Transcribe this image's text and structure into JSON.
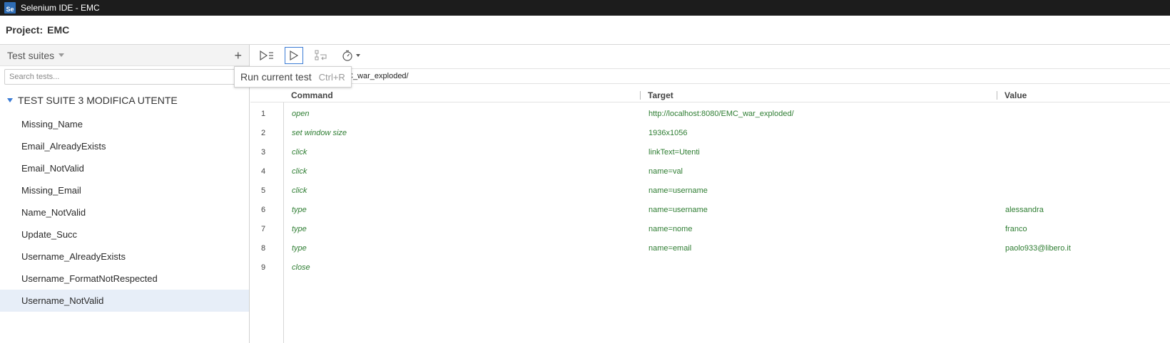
{
  "window": {
    "title": "Selenium IDE - EMC",
    "logo_text": "Se"
  },
  "project": {
    "label": "Project:",
    "name": "EMC"
  },
  "sidebar": {
    "dropdown_label": "Test suites",
    "add_label": "+",
    "search_placeholder": "Search tests...",
    "suite_name": "TEST SUITE 3 MODIFICA UTENTE",
    "tests": [
      "Missing_Name",
      "Email_AlreadyExists",
      "Email_NotValid",
      "Missing_Email",
      "Name_NotValid",
      "Update_Succ",
      "Username_AlreadyExists",
      "Username_FormatNotRespected",
      "Username_NotValid"
    ],
    "selected_test": "Username_NotValid"
  },
  "toolbar": {
    "buttons": [
      "run-all-tests-icon",
      "run-current-test-icon",
      "step-over-icon",
      "test-speed-icon"
    ],
    "tooltip": {
      "label": "Run current test",
      "shortcut": "Ctrl+R"
    }
  },
  "url_bar": {
    "visible_text": "C_war_exploded/"
  },
  "table": {
    "headers": {
      "command": "Command",
      "target": "Target",
      "value": "Value"
    },
    "rows": [
      {
        "num": "1",
        "command": "open",
        "target": "http://localhost:8080/EMC_war_exploded/",
        "value": ""
      },
      {
        "num": "2",
        "command": "set window size",
        "target": "1936x1056",
        "value": ""
      },
      {
        "num": "3",
        "command": "click",
        "target": "linkText=Utenti",
        "value": ""
      },
      {
        "num": "4",
        "command": "click",
        "target": "name=val",
        "value": ""
      },
      {
        "num": "5",
        "command": "click",
        "target": "name=username",
        "value": ""
      },
      {
        "num": "6",
        "command": "type",
        "target": "name=username",
        "value": "alessandra"
      },
      {
        "num": "7",
        "command": "type",
        "target": "name=nome",
        "value": "franco"
      },
      {
        "num": "8",
        "command": "type",
        "target": "name=email",
        "value": "paolo933@libero.it"
      },
      {
        "num": "9",
        "command": "close",
        "target": "",
        "value": ""
      }
    ]
  },
  "colors": {
    "accent": "#3a7bd5",
    "command_text": "#2e7d32",
    "selected_row": "#e7eef8"
  }
}
